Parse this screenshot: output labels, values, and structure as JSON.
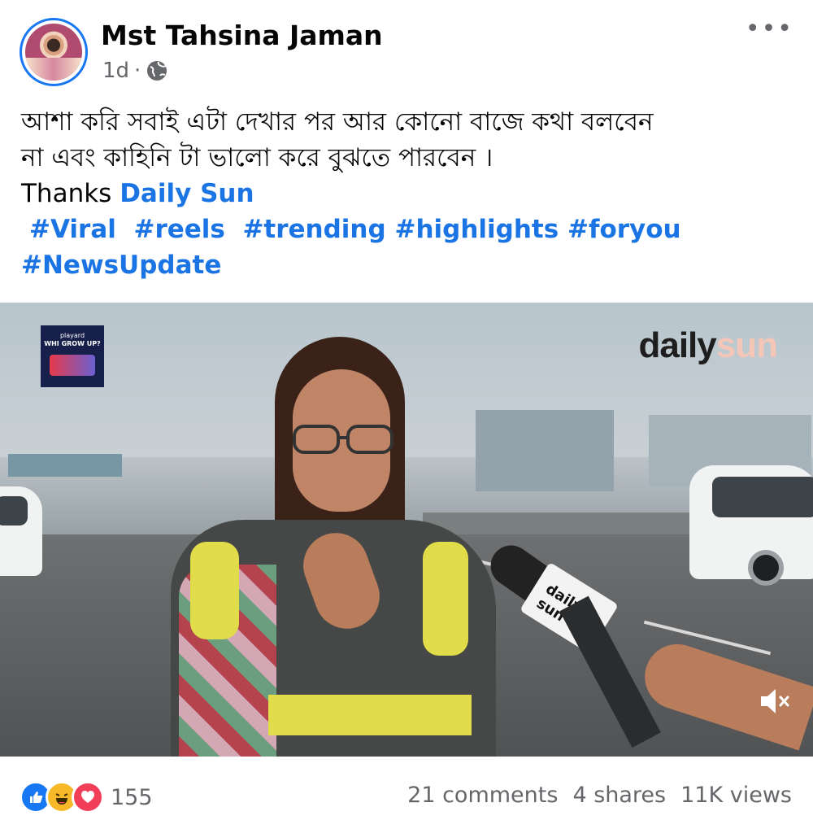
{
  "post": {
    "author": "Mst Tahsina Jaman",
    "time": "1d",
    "separator": "·",
    "more_label": "•••",
    "caption_line1": "আশা করি সবাই এটা দেখার পর আর কোনো বাজে কথা বলবেন",
    "caption_line2": "না এবং কাহিনি টা ভালো করে বুঝতে পারবেন ।",
    "thanks_label": "Thanks",
    "thanks_link": "Daily Sun",
    "hashtags_line1": "#Viral  #reels  #trending #highlights #foryou",
    "hashtags_line2": "#NewsUpdate"
  },
  "video": {
    "watermark_main": "daily",
    "watermark_accent": "sun",
    "mic_flag_label": "daily sun",
    "badge_text_line1": "playard",
    "badge_text_line2": "WHI GROW UP?",
    "muted": true
  },
  "footer": {
    "reaction_count": "155",
    "comments": "21 comments",
    "shares": "4 shares",
    "views": "11K views"
  },
  "icons": [
    "globe-icon",
    "more-icon",
    "like-reaction-icon",
    "haha-reaction-icon",
    "love-reaction-icon",
    "muted-speaker-icon"
  ],
  "colors": {
    "link": "#1b74e4",
    "meta": "#65676b",
    "avatar_ring": "#1877f2"
  }
}
